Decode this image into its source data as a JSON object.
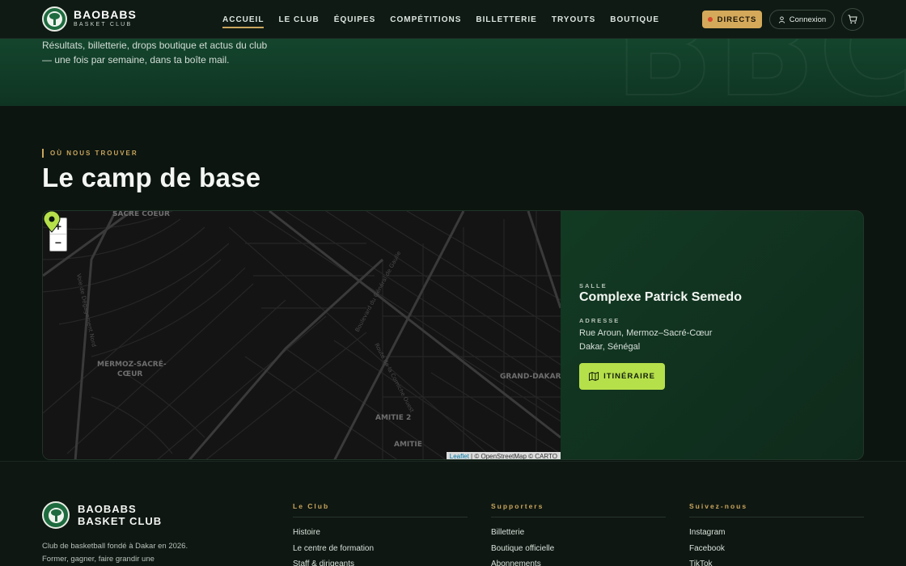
{
  "header": {
    "brand_name": "BAOBABS",
    "brand_sub": "BASKET CLUB",
    "nav": [
      {
        "label": "ACCUEIL",
        "active": true
      },
      {
        "label": "LE CLUB",
        "active": false
      },
      {
        "label": "ÉQUIPES",
        "active": false
      },
      {
        "label": "COMPÉTITIONS",
        "active": false
      },
      {
        "label": "BILLETTERIE",
        "active": false
      },
      {
        "label": "TRYOUTS",
        "active": false
      },
      {
        "label": "BOUTIQUE",
        "active": false
      }
    ],
    "directs_label": "DIRECTS",
    "connexion_label": "Connexion",
    "cart_icon": "cart-icon"
  },
  "newsletter": {
    "text": "Résultats, billetterie, drops boutique et actus du club — une fois par semaine, dans ta boîte mail."
  },
  "location": {
    "eyebrow": "OÙ NOUS TROUVER",
    "title": "Le camp de base",
    "map": {
      "zoom_in": "+",
      "zoom_out": "−",
      "labels": [
        "SACRE COEUR",
        "MERMOZ-SACRÉ-",
        "CŒUR",
        "GRAND-DAKAR",
        "AMITIE 2",
        "AMITIE",
        "Voie de Dégagement Nord",
        "Boulevard du Général de Gaulle",
        "Route de la Corniche Ouest"
      ],
      "attribution_leaflet": "Leaflet",
      "attribution_rest": "| © OpenStreetMap © CARTO"
    },
    "venue_label": "SALLE",
    "venue_name": "Complexe Patrick Semedo",
    "address_label": "ADRESSE",
    "address_line1": "Rue Aroun, Mermoz–Sacré-Cœur",
    "address_line2": "Dakar, Sénégal",
    "route_button": "ITINÉRAIRE"
  },
  "footer": {
    "brand_line1": "BAOBABS",
    "brand_line2": "BASKET CLUB",
    "description": "Club de basketball fondé à Dakar en 2026. Former, gagner, faire grandir une",
    "columns": [
      {
        "title": "Le Club",
        "links": [
          "Histoire",
          "Le centre de formation",
          "Staff & dirigeants"
        ]
      },
      {
        "title": "Supporters",
        "links": [
          "Billetterie",
          "Boutique officielle",
          "Abonnements"
        ]
      },
      {
        "title": "Suivez-nous",
        "links": [
          "Instagram",
          "Facebook",
          "TikTok"
        ]
      }
    ]
  },
  "colors": {
    "accent_gold": "#c9a65c",
    "lime": "#b6e04a",
    "brand_green": "#1e6b3f"
  }
}
